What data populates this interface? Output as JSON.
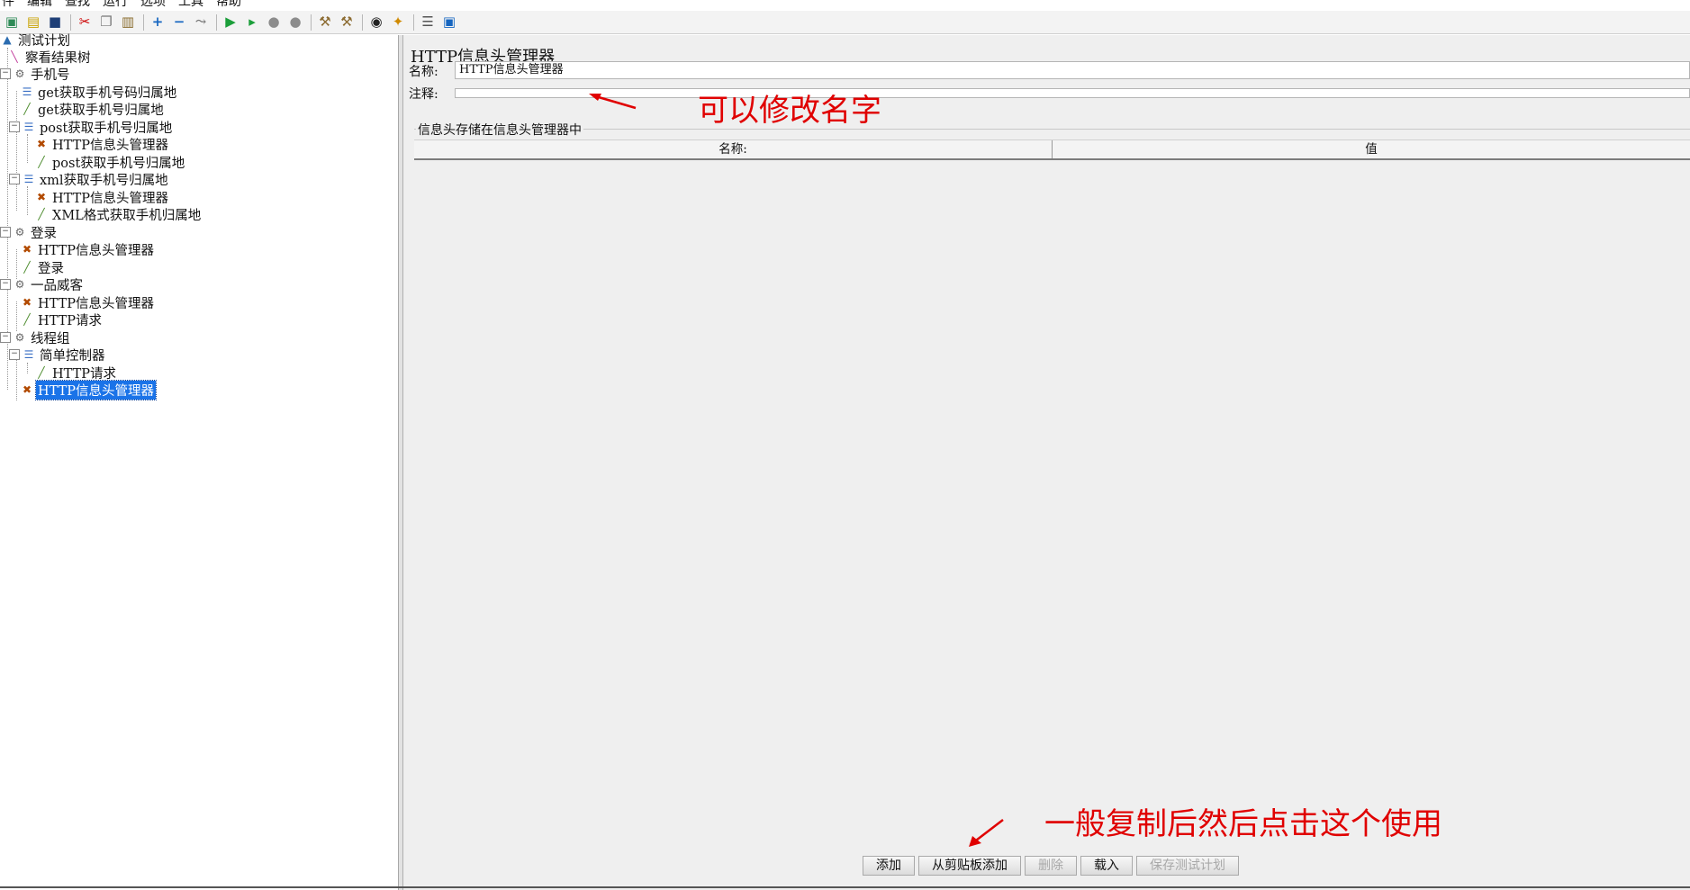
{
  "menubar": {
    "items": [
      "件",
      "编辑",
      "查找",
      "运行",
      "选项",
      "工具",
      "帮助"
    ]
  },
  "toolbar": {
    "icons": [
      "new-plan-icon",
      "open-folder-icon",
      "save-icon",
      "cut-icon",
      "copy-icon",
      "paste-icon",
      "expand-icon",
      "collapse-icon",
      "toggle-icon",
      "start-icon",
      "start-no-pause-icon",
      "stop-icon",
      "shutdown-icon",
      "clear-icon",
      "clear-all-icon",
      "search-icon",
      "reset-search-icon",
      "function-helper-icon",
      "help-icon"
    ]
  },
  "tree": {
    "nodes": [
      {
        "label": "测试计划",
        "icon": "test-plan-icon"
      },
      {
        "label": "察看结果树",
        "icon": "listener-icon"
      },
      {
        "label": "手机号",
        "icon": "thread-group-icon"
      },
      {
        "label": "get获取手机号码归属地",
        "icon": "controller-icon"
      },
      {
        "label": "get获取手机号归属地",
        "icon": "sampler-icon"
      },
      {
        "label": "post获取手机号归属地",
        "icon": "controller-icon"
      },
      {
        "label": "HTTP信息头管理器",
        "icon": "config-icon"
      },
      {
        "label": "post获取手机号归属地",
        "icon": "sampler-icon"
      },
      {
        "label": "xml获取手机号归属地",
        "icon": "controller-icon"
      },
      {
        "label": "HTTP信息头管理器",
        "icon": "config-icon"
      },
      {
        "label": "XML格式获取手机归属地",
        "icon": "sampler-icon"
      },
      {
        "label": "登录",
        "icon": "thread-group-icon"
      },
      {
        "label": "HTTP信息头管理器",
        "icon": "config-icon"
      },
      {
        "label": "登录",
        "icon": "sampler-icon"
      },
      {
        "label": "一品威客",
        "icon": "thread-group-icon"
      },
      {
        "label": "HTTP信息头管理器",
        "icon": "config-icon"
      },
      {
        "label": "HTTP请求",
        "icon": "sampler-icon"
      },
      {
        "label": "线程组",
        "icon": "thread-group-icon"
      },
      {
        "label": "简单控制器",
        "icon": "controller-icon"
      },
      {
        "label": "HTTP请求",
        "icon": "sampler-icon"
      },
      {
        "label": "HTTP信息头管理器",
        "icon": "config-icon",
        "selected": true
      }
    ]
  },
  "panel": {
    "title": "HTTP信息头管理器",
    "name_label": "名称:",
    "name_value": "HTTP信息头管理器",
    "comment_label": "注释:",
    "comment_value": "",
    "group_title": "信息头存储在信息头管理器中",
    "columns": [
      "名称:",
      "值"
    ],
    "buttons": [
      {
        "label": "添加",
        "enabled": true
      },
      {
        "label": "从剪贴板添加",
        "enabled": true
      },
      {
        "label": "删除",
        "enabled": false
      },
      {
        "label": "载入",
        "enabled": true
      },
      {
        "label": "保存测试计划",
        "enabled": false
      }
    ]
  },
  "annotations": {
    "rename_note": "可以修改名字",
    "clipboard_note": "一般复制后然后点击这个使用",
    "color": "#e00000"
  },
  "colors": {
    "selection": "#1a73e8",
    "panel_bg": "#efefef"
  }
}
